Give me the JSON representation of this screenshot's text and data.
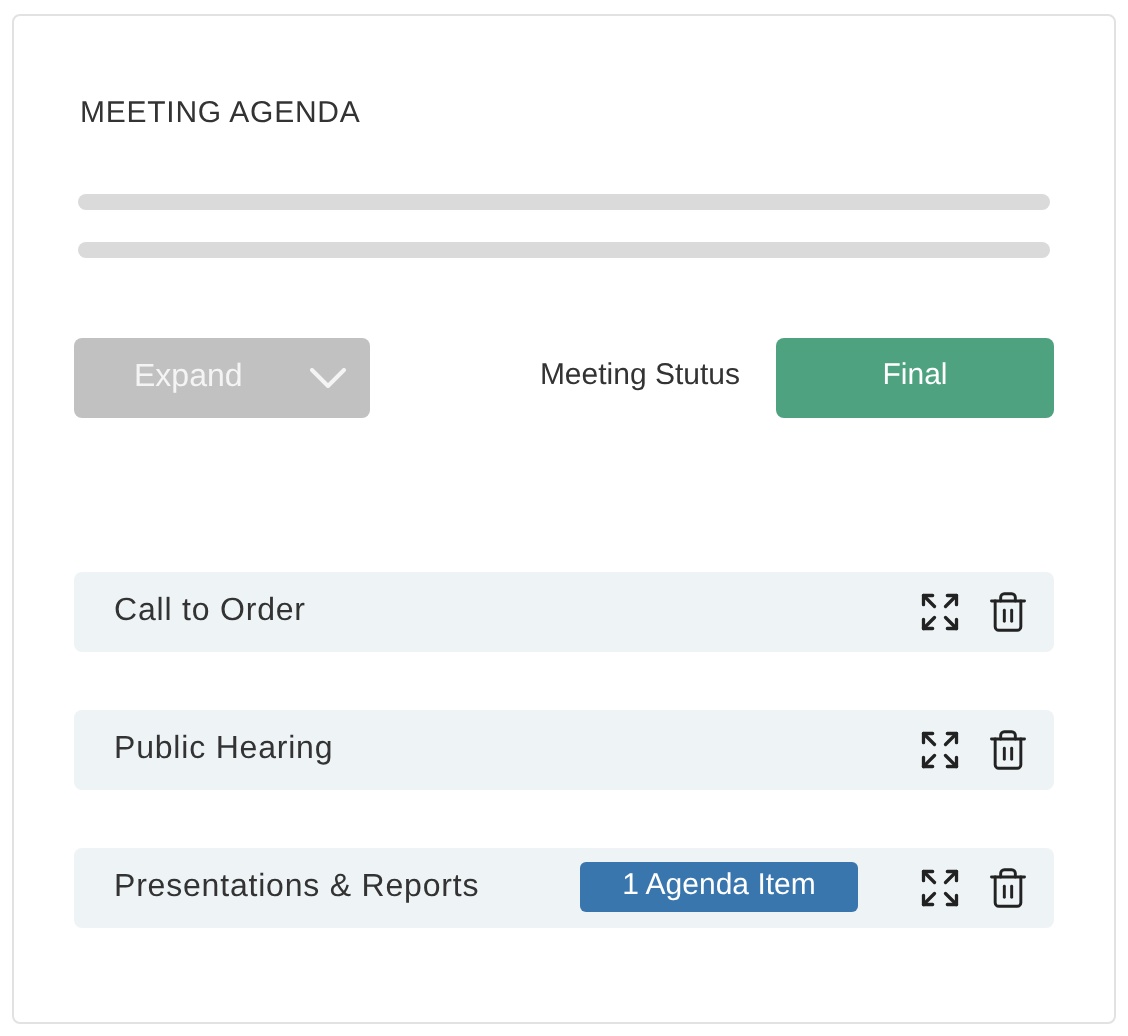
{
  "title": "MEETING AGENDA",
  "expand_button": {
    "label": "Expand",
    "disabled": true
  },
  "status": {
    "label": "Meeting Stutus",
    "value": "Final"
  },
  "items": [
    {
      "title": "Call to Order"
    },
    {
      "title": "Public Hearing"
    },
    {
      "title": "Presentations & Reports",
      "badge": "1 Agenda Item"
    }
  ]
}
